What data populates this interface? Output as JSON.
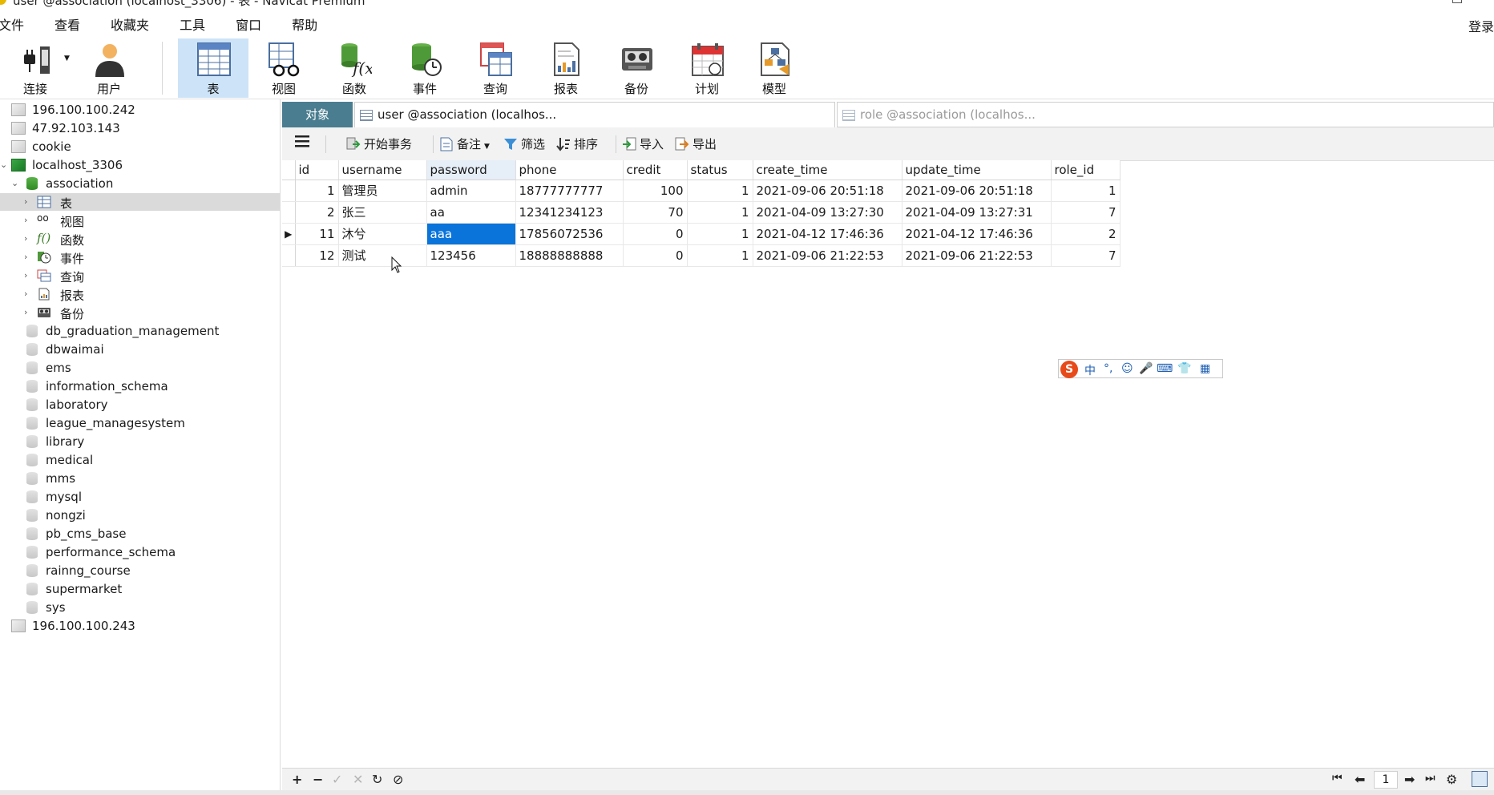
{
  "window": {
    "title": "user @association (localhost_3306) - 表 - Navicat Premium"
  },
  "menu": {
    "items": [
      "文件",
      "查看",
      "收藏夹",
      "工具",
      "窗口",
      "帮助"
    ],
    "login": "登录"
  },
  "toolbar": {
    "connect": "连接",
    "user": "用户",
    "table": "表",
    "view": "视图",
    "function": "函数",
    "event": "事件",
    "query": "查询",
    "report": "报表",
    "backup": "备份",
    "schedule": "计划",
    "model": "模型"
  },
  "tree": {
    "connections_top": [
      "196.100.100.242",
      "47.92.103.143",
      "cookie"
    ],
    "active_connection": "localhost_3306",
    "active_database": "association",
    "objects": [
      "表",
      "视图",
      "函数",
      "事件",
      "查询",
      "报表",
      "备份"
    ],
    "databases": [
      "db_graduation_management",
      "dbwaimai",
      "ems",
      "information_schema",
      "laboratory",
      "league_managesystem",
      "library",
      "medical",
      "mms",
      "mysql",
      "nongzi",
      "pb_cms_base",
      "performance_schema",
      "rainng_course",
      "supermarket",
      "sys"
    ],
    "connections_bottom": [
      "196.100.100.243"
    ]
  },
  "tabs": {
    "objects": "对象",
    "user": "user @association (localhos...",
    "role": "role @association (localhos..."
  },
  "object_toolbar": {
    "begin_transaction": "开始事务",
    "comment": "备注",
    "filter": "筛选",
    "sort": "排序",
    "import": "导入",
    "export": "导出"
  },
  "grid": {
    "columns": [
      "id",
      "username",
      "password",
      "phone",
      "credit",
      "status",
      "create_time",
      "update_time",
      "role_id"
    ],
    "rows": [
      [
        "1",
        "管理员",
        "admin",
        "18777777777",
        "100",
        "1",
        "2021-09-06 20:51:18",
        "2021-09-06 20:51:18",
        "1"
      ],
      [
        "2",
        "张三",
        "aa",
        "12341234123",
        "70",
        "1",
        "2021-04-09 13:27:30",
        "2021-04-09 13:27:31",
        "7"
      ],
      [
        "11",
        "沐兮",
        "aaa",
        "17856072536",
        "0",
        "1",
        "2021-04-12 17:46:36",
        "2021-04-12 17:46:36",
        "2"
      ],
      [
        "12",
        "测试",
        "123456",
        "18888888888",
        "0",
        "1",
        "2021-09-06 21:22:53",
        "2021-09-06 21:22:53",
        "7"
      ]
    ]
  },
  "ime": {
    "logo": "S",
    "items": [
      "中",
      "°,",
      "☺",
      "🎤",
      "⌨",
      "👕",
      "▦"
    ]
  },
  "status": {
    "page": "1"
  },
  "colors": {
    "selection": "#0a74da",
    "active_tool": "#cde3f7",
    "objects_tab": "#4a7d8f"
  }
}
